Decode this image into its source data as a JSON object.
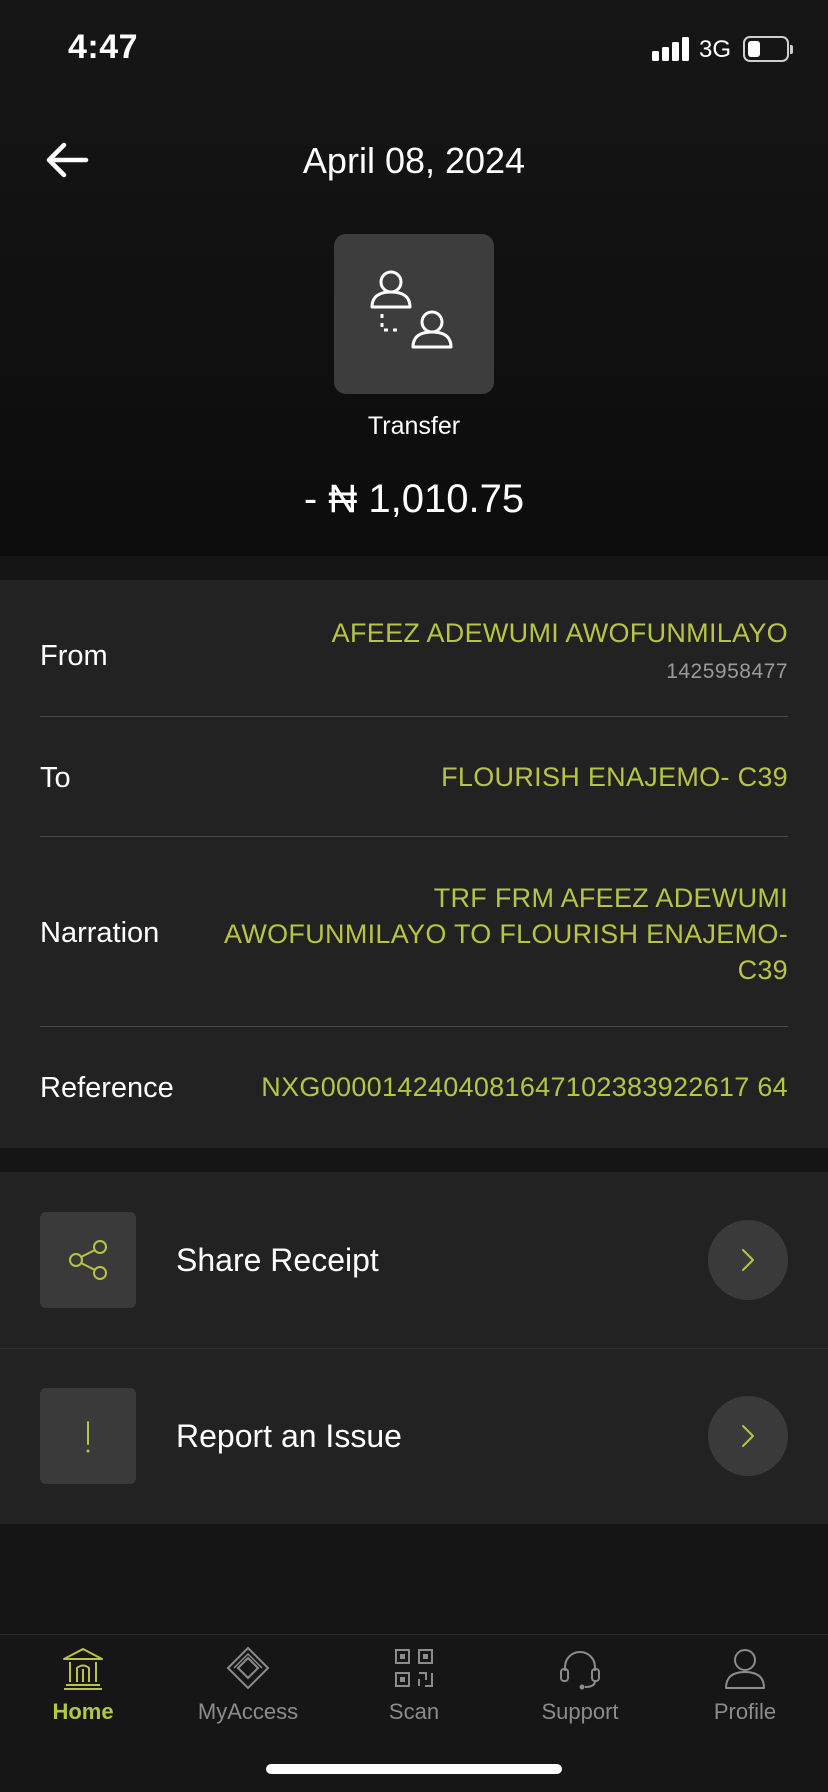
{
  "status_bar": {
    "time": "4:47",
    "network": "3G"
  },
  "header": {
    "title": "April 08, 2024",
    "transaction_type": "Transfer",
    "amount": "- ₦ 1,010.75"
  },
  "details": {
    "from": {
      "label": "From",
      "name": "AFEEZ ADEWUMI AWOFUNMILAYO",
      "account": "1425958477"
    },
    "to": {
      "label": "To",
      "name": "FLOURISH ENAJEMO- C39"
    },
    "narration": {
      "label": "Narration",
      "lines": [
        "TRF FRM AFEEZ ADEWUMI",
        "AWOFUNMILAYO TO FLOURISH ENAJEMO-",
        "C39"
      ]
    },
    "reference": {
      "label": "Reference",
      "value": "NXG0000142404081647102383922617 64"
    }
  },
  "actions": [
    {
      "label": "Share Receipt",
      "icon": "share-icon"
    },
    {
      "label": "Report an Issue",
      "icon": "exclamation-icon"
    }
  ],
  "tab_bar": {
    "tabs": [
      {
        "label": "Home",
        "icon": "bank-icon",
        "active": true
      },
      {
        "label": "MyAccess",
        "icon": "diamond-icon",
        "active": false
      },
      {
        "label": "Scan",
        "icon": "qr-icon",
        "active": false
      },
      {
        "label": "Support",
        "icon": "headset-icon",
        "active": false
      },
      {
        "label": "Profile",
        "icon": "person-icon",
        "active": false
      }
    ]
  },
  "colors": {
    "accent": "#b5c544",
    "background": "#141414",
    "card": "#222222",
    "icon_box": "#3d3d3d"
  }
}
